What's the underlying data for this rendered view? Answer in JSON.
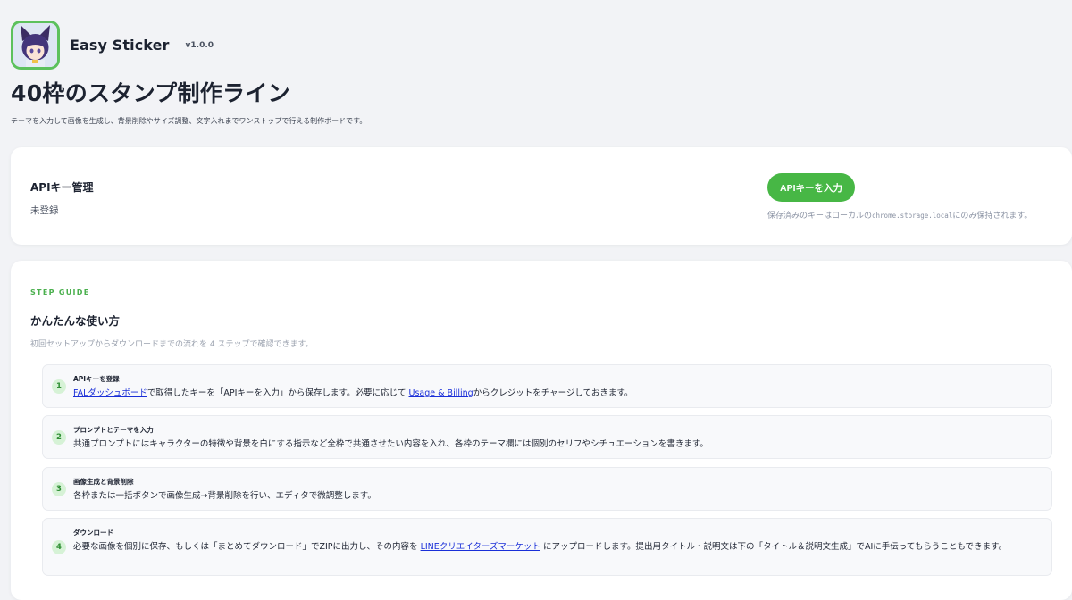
{
  "header": {
    "app_name": "Easy Sticker",
    "version": "v1.0.0",
    "icon": "cat-girl-avatar-icon"
  },
  "page": {
    "title": "40枠のスタンプ制作ライン",
    "subtitle": "テーマを入力して画像を生成し、背景削除やサイズ調整、文字入れまでワンストップで行える制作ボードです。"
  },
  "api": {
    "title": "APIキー管理",
    "status": "未登録",
    "button_label": "APIキーを入力",
    "note_before": "保存済みのキーはローカルの",
    "note_code": "chrome.storage.local",
    "note_after": "にのみ保持されます。"
  },
  "guide": {
    "label": "STEP GUIDE",
    "title": "かんたんな使い方",
    "description": "初回セットアップからダウンロードまでの流れを 4 ステップで確認できます。",
    "steps": [
      {
        "number": "1",
        "title": "APIキーを登録",
        "link1": "FALダッシュボード",
        "text1": "で取得したキーを「APIキーを入力」から保存します。必要に応じて ",
        "link2": "Usage & Billing",
        "text2": "からクレジットをチャージしておきます。"
      },
      {
        "number": "2",
        "title": "プロンプトとテーマを入力",
        "text": "共通プロンプトにはキャラクターの特徴や背景を白にする指示など全枠で共通させたい内容を入れ、各枠のテーマ欄には個別のセリフやシチュエーションを書きます。"
      },
      {
        "number": "3",
        "title": "画像生成と背景削除",
        "text": "各枠または一括ボタンで画像生成→背景削除を行い、エディタで微調整します。"
      },
      {
        "number": "4",
        "title": "ダウンロード",
        "text1": "必要な画像を個別に保存、もしくは「まとめてダウンロード」でZIPに出力し、その内容を ",
        "link": "LINEクリエイターズマーケット",
        "text2": " にアップロードします。提出用タイトル・説明文は下の「タイトル＆説明文生成」でAIに手伝ってもらうこともできます。"
      }
    ]
  },
  "colors": {
    "accent": "#47b745",
    "background": "#f2f3f6",
    "link": "#1a2fd8"
  }
}
